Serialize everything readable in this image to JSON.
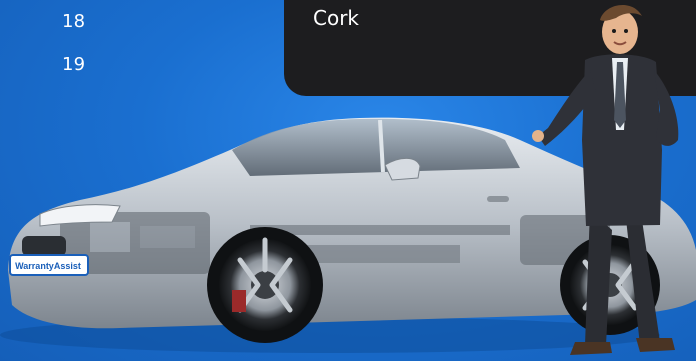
{
  "list": {
    "numbers": [
      "18",
      "19"
    ]
  },
  "location_panel": {
    "city": "Cork"
  },
  "hero": {
    "plate_text": "WarrantyAssist",
    "colors": {
      "background": "#1b72d4",
      "panel": "#1d1d1f",
      "text": "#ffffff"
    }
  }
}
